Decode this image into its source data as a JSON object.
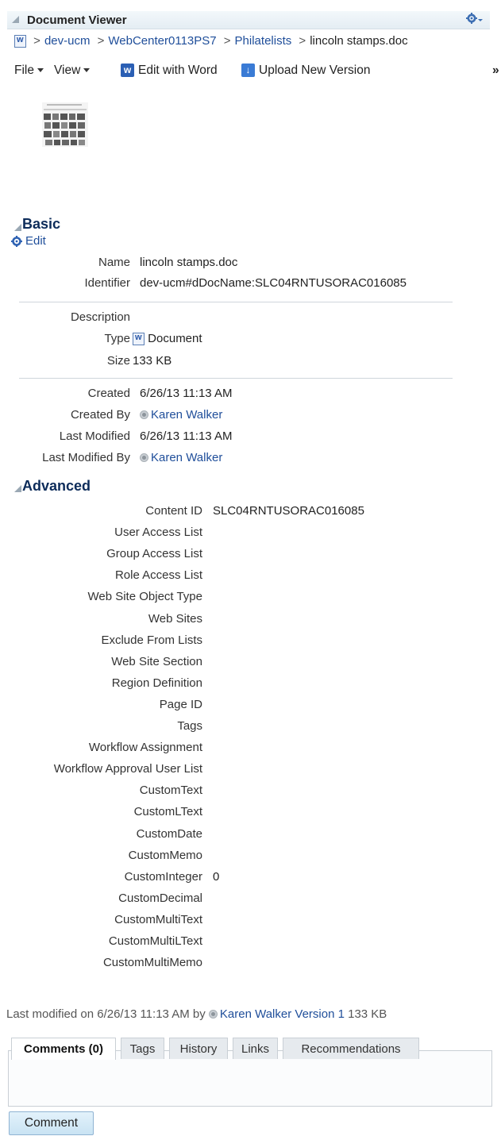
{
  "panel": {
    "title": "Document Viewer",
    "settings_icon": "gear-dropdown-icon"
  },
  "breadcrumb": {
    "items": [
      "dev-ucm",
      "WebCenter0113PS7",
      "Philatelists"
    ],
    "current": "lincoln stamps.doc",
    "separator": ">"
  },
  "toolbar": {
    "file": "File",
    "view": "View",
    "edit_with_word": "Edit with Word",
    "upload_new_version": "Upload New Version",
    "overflow": "»"
  },
  "basic": {
    "heading": "Basic",
    "edit_label": "Edit",
    "name_label": "Name",
    "name_value": "lincoln stamps.doc",
    "identifier_label": "Identifier",
    "identifier_value": "dev-ucm#dDocName:SLC04RNTUSORAC016085",
    "description_label": "Description",
    "type_label": "Type",
    "type_value": "Document",
    "size_label": "Size",
    "size_value": "133 KB",
    "created_label": "Created",
    "created_value": "6/26/13 11:13 AM",
    "created_by_label": "Created By",
    "created_by_value": "Karen Walker",
    "last_modified_label": "Last Modified",
    "last_modified_value": "6/26/13 11:13 AM",
    "last_modified_by_label": "Last Modified By",
    "last_modified_by_value": "Karen Walker"
  },
  "advanced": {
    "heading": "Advanced",
    "fields": [
      {
        "label": "Content ID",
        "value": "SLC04RNTUSORAC016085"
      },
      {
        "label": "User Access List",
        "value": ""
      },
      {
        "label": "Group Access List",
        "value": ""
      },
      {
        "label": "Role Access List",
        "value": ""
      },
      {
        "label": "Web Site Object Type",
        "value": ""
      },
      {
        "label": "Web Sites",
        "value": ""
      },
      {
        "label": "Exclude From Lists",
        "value": ""
      },
      {
        "label": "Web Site Section",
        "value": ""
      },
      {
        "label": "Region Definition",
        "value": ""
      },
      {
        "label": "Page ID",
        "value": ""
      },
      {
        "label": "Tags",
        "value": ""
      },
      {
        "label": "Workflow Assignment",
        "value": ""
      },
      {
        "label": "Workflow Approval User List",
        "value": ""
      },
      {
        "label": "CustomText",
        "value": ""
      },
      {
        "label": "CustomLText",
        "value": ""
      },
      {
        "label": "CustomDate",
        "value": ""
      },
      {
        "label": "CustomMemo",
        "value": ""
      },
      {
        "label": "CustomInteger",
        "value": "0"
      },
      {
        "label": "CustomDecimal",
        "value": ""
      },
      {
        "label": "CustomMultiText",
        "value": ""
      },
      {
        "label": "CustomMultiLText",
        "value": ""
      },
      {
        "label": "CustomMultiMemo",
        "value": ""
      }
    ]
  },
  "footer": {
    "prefix": "Last modified on 6/26/13 11:13 AM  by",
    "user": "Karen Walker",
    "version": "Version 1",
    "size": "133 KB"
  },
  "tabs": [
    "Comments (0)",
    "Tags",
    "History",
    "Links",
    "Recommendations"
  ],
  "comment_button": "Comment"
}
